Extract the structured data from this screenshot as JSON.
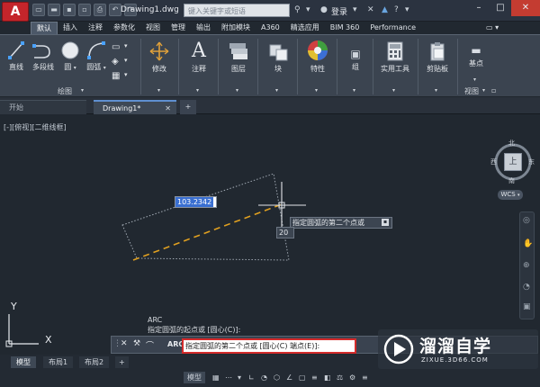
{
  "app": {
    "logo_letter": "A",
    "title": "Drawing1.dwg",
    "search_placeholder": "键入关键字或短语",
    "login": "登录"
  },
  "ribbon_tabs": [
    "默认",
    "插入",
    "注释",
    "参数化",
    "视图",
    "管理",
    "输出",
    "附加模块",
    "A360",
    "精选应用",
    "BIM 360",
    "Performance"
  ],
  "ribbon": {
    "draw": {
      "line": "直线",
      "polyline": "多段线",
      "circle": "圆",
      "arc": "圆弧",
      "panel": "绘图"
    },
    "modify": "修改",
    "annotation": "注释",
    "layers": "图层",
    "block": "块",
    "properties": "特性",
    "groups": "组",
    "utilities": "实用工具",
    "clipboard": "剪贴板",
    "base": "基点",
    "view_panel": "视图"
  },
  "file_tabs": {
    "start": "开始",
    "drawing": "Drawing1*",
    "add": "+"
  },
  "viewport": {
    "label": "[-][俯视][二维线框]"
  },
  "viewcube": {
    "north": "北",
    "south": "南",
    "west": "西",
    "east": "东",
    "top": "上",
    "wcs": "WCS"
  },
  "drawing": {
    "dimension_value": "103.2342",
    "tooltip": "指定圆弧的第二个点或",
    "dynamic_value": "20"
  },
  "ucs": {
    "x": "X",
    "y": "Y"
  },
  "command": {
    "history_1": "ARC",
    "history_2": "指定圆弧的起点或 [圆心(C)]:",
    "prompt_cmd": "ARC",
    "input": "指定圆弧的第二个点或 [圆心(C) 端点(E)]:"
  },
  "layout_tabs": [
    "模型",
    "布局1",
    "布局2"
  ],
  "status": {
    "model": "模型"
  },
  "watermark": {
    "brand": "溜溜自学",
    "url": "ZIXUE.3D66.COM"
  },
  "colors": {
    "accent_red": "#c4252b",
    "dash_orange": "#e0a020",
    "dim_highlight": "#3a6fd1",
    "input_border": "#d42b2b"
  }
}
